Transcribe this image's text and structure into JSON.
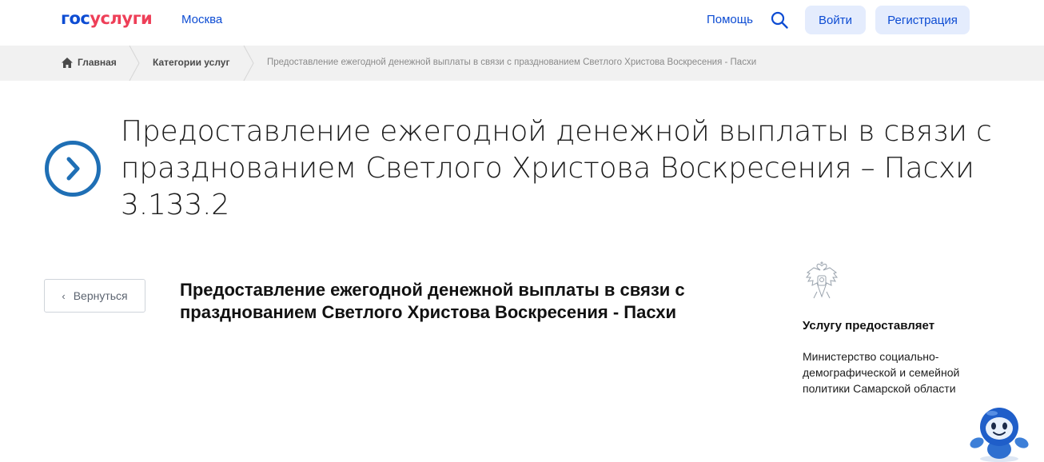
{
  "header": {
    "logo_gos": "гос",
    "logo_uslugi": "услуги",
    "city": "Москва",
    "help": "Помощь",
    "login": "Войти",
    "register": "Регистрация"
  },
  "breadcrumbs": {
    "home": "Главная",
    "categories": "Категории услуг",
    "current": "Предоставление ежегодной денежной выплаты в связи с празднованием Светлого Христова Воскресения - Пасхи"
  },
  "title": {
    "line1": "Предоставление ежегодной денежной выплаты в связи с",
    "line2": "празднованием Светлого Христова Воскресения – Пасхи",
    "line3": "3.133.2"
  },
  "back_button": "Вернуться",
  "service": {
    "line1": "Предоставление ежегодной денежной выплаты в связи с",
    "line2": "празднованием Светлого Христова Воскресения - Пасхи"
  },
  "provider": {
    "label": "Услугу предоставляет",
    "line1": "Министерство социально-",
    "line2": "демографической и семейной",
    "line3": "политики Самарской области"
  },
  "colors": {
    "accent": "#0d4cd3",
    "brand_red": "#ee3f58",
    "button_bg": "#e4ecfd",
    "breadcrumb_bg": "#f1f1f1",
    "title_icon": "#1f6fb5"
  }
}
